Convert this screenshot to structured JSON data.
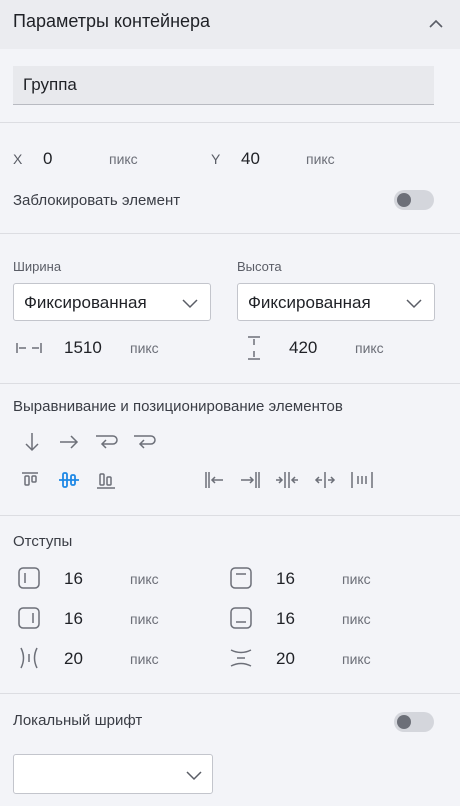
{
  "header": {
    "title": "Параметры контейнера"
  },
  "name_field": {
    "value": "Группа"
  },
  "position": {
    "x_label": "X",
    "x_value": "0",
    "x_unit": "пикс",
    "y_label": "Y",
    "y_value": "40",
    "y_unit": "пикс",
    "lock_label": "Заблокировать элемент"
  },
  "size": {
    "width_label": "Ширина",
    "width_mode": "Фиксированная",
    "width_value": "1510",
    "width_unit": "пикс",
    "height_label": "Высота",
    "height_mode": "Фиксированная",
    "height_value": "420",
    "height_unit": "пикс"
  },
  "alignment": {
    "title": "Выравнивание и позиционирование элементов"
  },
  "padding": {
    "title": "Отступы",
    "left_value": "16",
    "left_unit": "пикс",
    "top_value": "16",
    "top_unit": "пикс",
    "right_value": "16",
    "right_unit": "пикс",
    "bottom_value": "16",
    "bottom_unit": "пикс",
    "gap_h_value": "20",
    "gap_h_unit": "пикс",
    "gap_v_value": "20",
    "gap_v_unit": "пикс"
  },
  "font": {
    "local_label": "Локальный шрифт",
    "selected": ""
  },
  "colors": {
    "accent": "#1e88e5",
    "icon": "#6c6f78"
  }
}
